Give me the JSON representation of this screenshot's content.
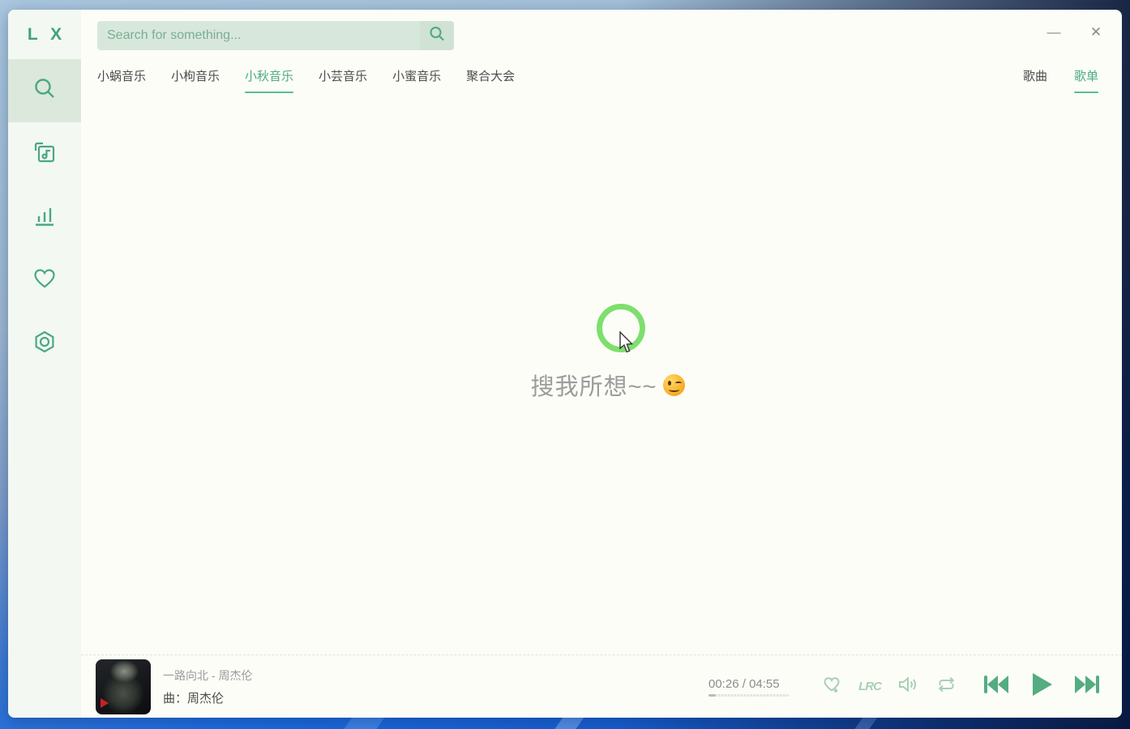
{
  "logo": {
    "text": "L X"
  },
  "topbar": {
    "search_placeholder": "Search for something...",
    "minimize_glyph": "—",
    "close_glyph": "✕"
  },
  "sidebar": {
    "items": [
      {
        "id": "search",
        "icon": "magnifier-icon",
        "active": true
      },
      {
        "id": "my-music",
        "icon": "music-square-icon",
        "active": false
      },
      {
        "id": "leaderboard",
        "icon": "bar-chart-icon",
        "active": false
      },
      {
        "id": "favorites",
        "icon": "heart-icon",
        "active": false
      },
      {
        "id": "settings",
        "icon": "gear-hexagon-icon",
        "active": false
      }
    ]
  },
  "source_tabs": {
    "items": [
      {
        "label": "小蜗音乐",
        "active": false
      },
      {
        "label": "小枸音乐",
        "active": false
      },
      {
        "label": "小秋音乐",
        "active": true
      },
      {
        "label": "小芸音乐",
        "active": false
      },
      {
        "label": "小蜜音乐",
        "active": false
      },
      {
        "label": "聚合大会",
        "active": false
      }
    ]
  },
  "type_tabs": {
    "song_label": "歌曲",
    "playlist_label": "歌单",
    "active": "歌单"
  },
  "content": {
    "hint_text": "搜我所想~~",
    "hint_emoji": "wink-emoji"
  },
  "player": {
    "song_title": "一路向北 - 周杰伦",
    "artist_line": "曲：周杰伦",
    "current_time": "00:26",
    "time_separator": "/",
    "total_time": "04:55",
    "progress_percent": 9,
    "lrc_label": "LRC"
  },
  "colors": {
    "accent": "#4aa883",
    "accent_faded": "#a9cfb6",
    "search_bg": "#d8e7db",
    "sidebar_active_bg": "#dce8db",
    "click_circle": "#7ddf6d"
  }
}
